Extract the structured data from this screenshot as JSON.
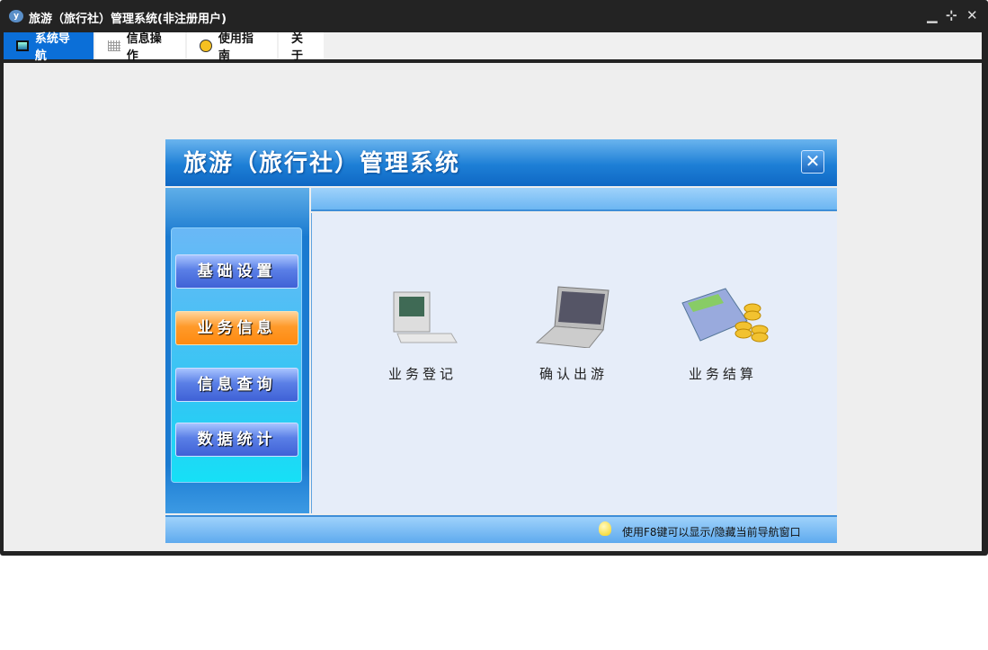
{
  "window": {
    "title": "旅游（旅行社）管理系统(非注册用户)",
    "logo": "y",
    "controls": {
      "minimize": "▁",
      "restore": "⊹",
      "close": "✕"
    }
  },
  "tabs": [
    {
      "label": "系统导航",
      "icon": "monitor-icon",
      "active": true
    },
    {
      "label": "信息操作",
      "icon": "grid-icon"
    },
    {
      "label": "使用指南",
      "icon": "help-icon"
    },
    {
      "label": "关于"
    }
  ],
  "panel": {
    "title": "旅游（旅行社）管理系统",
    "close": "✕",
    "menu": [
      {
        "label": "基础设置"
      },
      {
        "label": "业务信息",
        "active": true
      },
      {
        "label": "信息查询"
      },
      {
        "label": "数据统计"
      }
    ],
    "items": [
      {
        "label": "业务登记",
        "icon": "computer-icon"
      },
      {
        "label": "确认出游",
        "icon": "laptop-icon"
      },
      {
        "label": "业务结算",
        "icon": "calculator-coins-icon"
      }
    ],
    "footer": "使用F8键可以显示/隐藏当前导航窗口"
  }
}
